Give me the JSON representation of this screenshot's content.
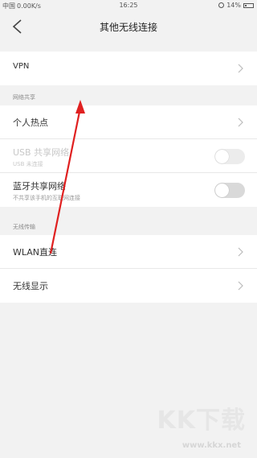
{
  "status_bar": {
    "signal": "中国",
    "speed": "0.00K/s",
    "time": "16:25",
    "battery": "14%"
  },
  "header": {
    "title": "其他无线连接"
  },
  "vpn": {
    "label": "VPN"
  },
  "network_sharing": {
    "section_title": "网络共享",
    "hotspot_label": "个人热点",
    "usb_label": "USB 共享网络",
    "usb_sub": "USB 未连接",
    "bt_label": "蓝牙共享网络",
    "bt_sub": "不共享该手机的互联网连接"
  },
  "wireless_transfer": {
    "section_title": "无线传输",
    "wlan_direct_label": "WLAN直连",
    "wireless_display_label": "无线显示"
  },
  "toggles": {
    "usb_on": false,
    "bt_on": false
  },
  "watermark": {
    "logo": "KK下载",
    "url": "www.kkx.net"
  },
  "colors": {
    "annotation_arrow": "#e02020",
    "background": "#f2f2f2"
  }
}
